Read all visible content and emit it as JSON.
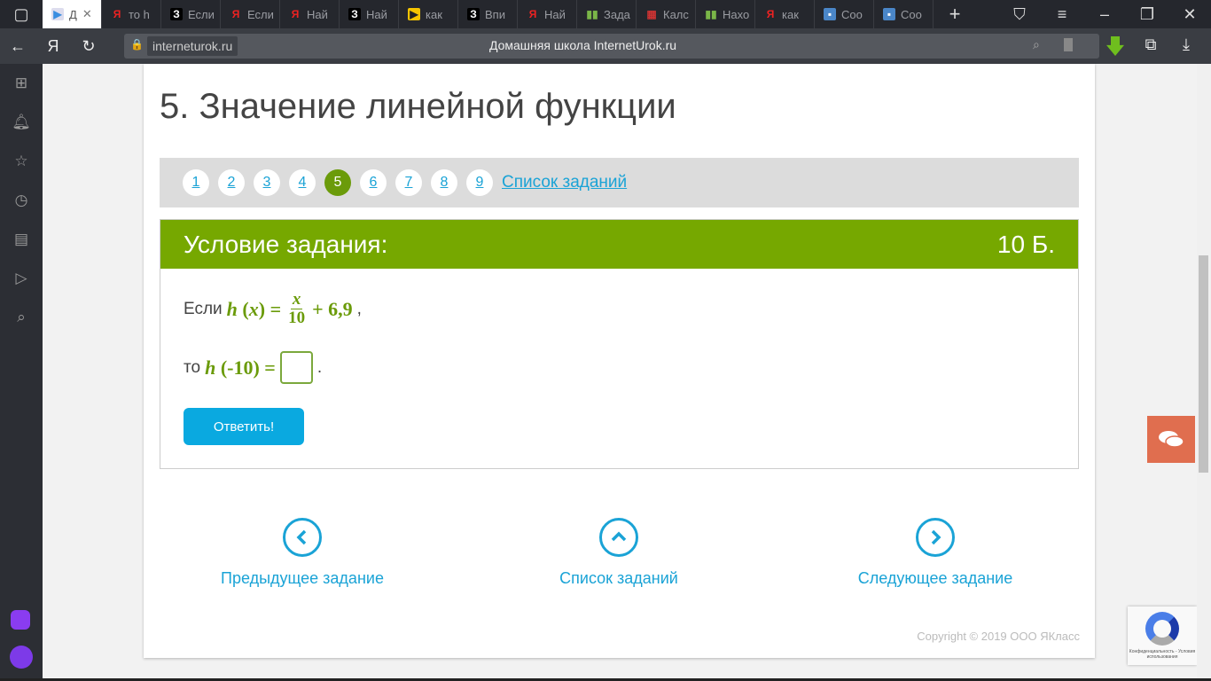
{
  "browser": {
    "tabs": [
      {
        "label": "Д",
        "icon": "play-icon",
        "active": true
      },
      {
        "label": "то h",
        "icon": "yandex-icon"
      },
      {
        "label": "Если",
        "icon": "z-icon"
      },
      {
        "label": "Если",
        "icon": "yandex-icon"
      },
      {
        "label": "Най",
        "icon": "yandex-icon"
      },
      {
        "label": "Най",
        "icon": "z-icon"
      },
      {
        "label": "как",
        "icon": "play-yellow-icon"
      },
      {
        "label": "Впи",
        "icon": "z-icon"
      },
      {
        "label": "Най",
        "icon": "yandex-icon"
      },
      {
        "label": "Зада",
        "icon": "book-icon"
      },
      {
        "label": "Калс",
        "icon": "cube-icon"
      },
      {
        "label": "Нахо",
        "icon": "book-icon"
      },
      {
        "label": "как",
        "icon": "yandex-icon"
      },
      {
        "label": "Соо",
        "icon": "chat-icon"
      },
      {
        "label": "Соо",
        "icon": "chat-icon"
      }
    ],
    "url_host": "interneturok.ru",
    "page_title": "Домашняя школа InternetUrok.ru"
  },
  "page": {
    "title": "5. Значение линейной функции",
    "pagination": [
      "1",
      "2",
      "3",
      "4",
      "5",
      "6",
      "7",
      "8",
      "9"
    ],
    "current_page": "5",
    "task_list_link": "Список заданий",
    "task": {
      "header": "Условие задания:",
      "points": "10 Б.",
      "line1_prefix": "Если",
      "func": "h",
      "var": "x",
      "numerator": "x",
      "denominator": "10",
      "plus_term": "+ 6,9",
      "line2_prefix": "то",
      "arg": "(-10)",
      "answer_value": "",
      "submit": "Ответить!"
    },
    "nav": {
      "prev": "Предыдущее задание",
      "list": "Список заданий",
      "next": "Следующее задание"
    },
    "copyright": "Copyright © 2019 ООО ЯКласс",
    "recaptcha": "Конфиденциальность - Условия использования"
  },
  "colors": {
    "accent_green": "#76a800",
    "link_blue": "#1aa3d6",
    "button_blue": "#0aa9e0",
    "chat_orange": "#e06e4f"
  }
}
